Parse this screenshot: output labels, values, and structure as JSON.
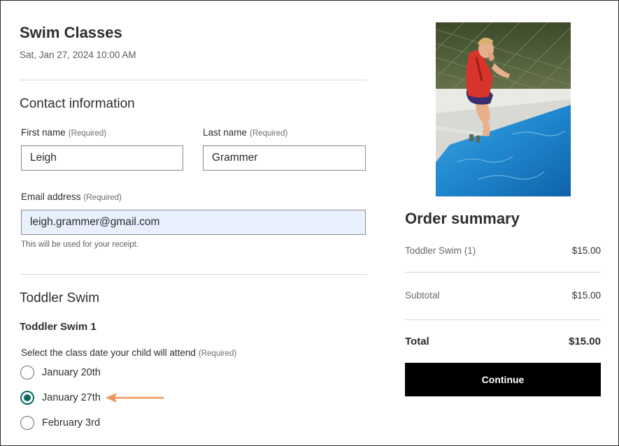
{
  "event": {
    "title": "Swim Classes",
    "datetime": "Sat, Jan 27, 2024 10:00 AM"
  },
  "contact": {
    "heading": "Contact information",
    "first_name": {
      "label": "First name",
      "required": "(Required)",
      "value": "Leigh"
    },
    "last_name": {
      "label": "Last name",
      "required": "(Required)",
      "value": "Grammer"
    },
    "email": {
      "label": "Email address",
      "required": "(Required)",
      "value": "leigh.grammer@gmail.com",
      "hint": "This will be used for your receipt."
    }
  },
  "ticket": {
    "heading": "Toddler Swim",
    "item_title": "Toddler Swim 1",
    "question": "Select the class date your child will attend",
    "question_required": "(Required)",
    "options": [
      {
        "label": "January 20th",
        "selected": false
      },
      {
        "label": "January 27th",
        "selected": true
      },
      {
        "label": "February 3rd",
        "selected": false
      }
    ]
  },
  "annotation": {
    "arrow_color": "#f0955a"
  },
  "photo": {
    "subject": "child-jumping-off-diving-board-icon"
  },
  "order_summary": {
    "heading": "Order summary",
    "line_item": {
      "label": "Toddler Swim (1)",
      "amount": "$15.00"
    },
    "subtotal": {
      "label": "Subtotal",
      "amount": "$15.00"
    },
    "total": {
      "label": "Total",
      "amount": "$15.00"
    },
    "continue_label": "Continue"
  },
  "colors": {
    "accent": "#0b6b63",
    "button_bg": "#000000",
    "autofill_bg": "#e8f0fe"
  }
}
